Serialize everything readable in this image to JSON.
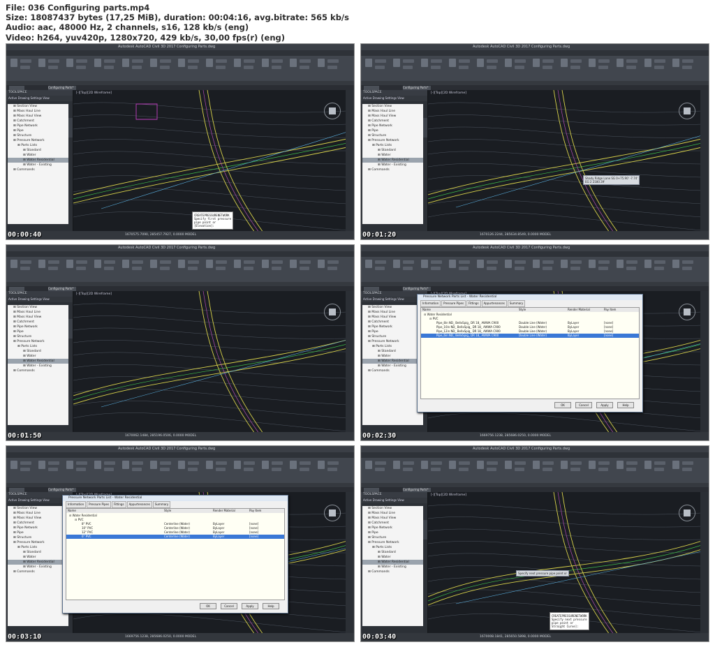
{
  "header": {
    "line1": "File: 036 Configuring parts.mp4",
    "line2": "Size: 18087437 bytes (17,25 MiB), duration: 00:04:16, avg.bitrate: 565 kb/s",
    "line3": "Audio: aac, 48000 Hz, 2 channels, s16, 128 kb/s (eng)",
    "line4": "Video: h264, yuv420p, 1280x720, 429 kb/s, 30,00 fps(r) (eng)"
  },
  "app": {
    "title": "Autodesk AutoCAD Civil 3D 2017    Configuring Parts.dwg",
    "ribbon_tabs": [
      "Home",
      "Insert",
      "Annotate",
      "Modify",
      "Analyze",
      "View",
      "Manage",
      "Output",
      "Survey",
      "Autodesk 360",
      "Help",
      "Add-ins",
      "Express Tools",
      "Vehicle Tracking",
      "Featured Apps",
      "BIM 360",
      "Performance",
      "Geolocation"
    ],
    "doc_tab": "Configuring Parts*",
    "toolspace_title": "TOOLSPACE",
    "toolspace_view": "Active Drawing Settings View",
    "tree": [
      "Section View",
      "Mass Haul Line",
      "Mass Haul View",
      "Catchment",
      "Pipe Network",
      "Pipe",
      "Structure",
      "Pressure Network",
      "Parts Lists",
      "Standard",
      "Water",
      "Water Residential",
      "Water - Existing",
      "Commands"
    ],
    "viewport_label": "[-][Top][2D Wireframe]"
  },
  "thumbnails": [
    {
      "timestamp": "00:00:40",
      "coords": "1670575.7090, 285457.7927, 0.0000  MODEL",
      "cmd": [
        "CREATEPRESSURENETWORK",
        "Specify first pressure",
        "pipe point or",
        "[Elevation]:"
      ]
    },
    {
      "timestamp": "00:01:20",
      "coords": "1670126.2244, 285634.8549, 0.0000  MODEL",
      "tooltip": [
        "Shady Ridge Lane   SG  0+75.90'  -7.74'",
        "EG   2  2180.39'"
      ]
    },
    {
      "timestamp": "00:01:50",
      "coords": "1670062.1484, 285196.0506, 0.0000  MODEL"
    },
    {
      "timestamp": "00:02:30",
      "coords": "1669756.1238, 285686.0250, 0.0000  MODEL",
      "dialog": {
        "title": "Pressure Network Parts List - Water Residential",
        "tabs": [
          "Information",
          "Pressure Pipes",
          "Fittings",
          "Appurtenances",
          "Summary"
        ],
        "cols": [
          "Name",
          "Style",
          "Render Material",
          "Pay Item"
        ],
        "root": "Water Residential",
        "group": "PVC",
        "rows": [
          {
            "name": "Pipe_8in ND_ BellxSpig_ DR 18_ AWWA C900",
            "style": "Double Line (Water)",
            "mat": "ByLayer",
            "pay": "[none]"
          },
          {
            "name": "Pipe_10in ND_ BellxSpig_ DR 18_ AWWA C900",
            "style": "Double Line (Water)",
            "mat": "ByLayer",
            "pay": "[none]"
          },
          {
            "name": "Pipe_12in ND_ BellxSpig_ DR 18_ AWWA C900",
            "style": "Double Line (Water)",
            "mat": "ByLayer",
            "pay": "[none]"
          },
          {
            "name": "Pipe_6in ND_ BellxSpig_ DR 18_ AWWA C900",
            "style": "Double Line (Water)",
            "mat": "ByLayer",
            "pay": "[none]"
          }
        ],
        "buttons": [
          "OK",
          "Cancel",
          "Apply",
          "Help"
        ]
      }
    },
    {
      "timestamp": "00:03:10",
      "coords": "1669756.1238, 285686.0250, 0.0000  MODEL",
      "dialog": {
        "title": "Pressure Network Parts List - Water Residential",
        "tabs": [
          "Information",
          "Pressure Pipes",
          "Fittings",
          "Appurtenances",
          "Summary"
        ],
        "cols": [
          "Name",
          "Style",
          "Render Material",
          "Pay Item"
        ],
        "root": "Water Residential",
        "group": "PVC",
        "rows": [
          {
            "name": "8\" PVC",
            "style": "Centerline (Water)",
            "mat": "ByLayer",
            "pay": "[none]"
          },
          {
            "name": "10\" PVC",
            "style": "Centerline (Water)",
            "mat": "ByLayer",
            "pay": "[none]"
          },
          {
            "name": "12\" PVC",
            "style": "Centerline (Water)",
            "mat": "ByLayer",
            "pay": "[none]"
          },
          {
            "name": "6\" PVC",
            "style": "Centerline (Water)",
            "mat": "ByLayer",
            "pay": "[none]"
          }
        ],
        "buttons": [
          "OK",
          "Cancel",
          "Apply",
          "Help"
        ]
      }
    },
    {
      "timestamp": "00:03:40",
      "coords": "1670008.1841, 285650.5898, 0.0000  MODEL",
      "cmd": [
        "CREATEPRESSURENETWORK",
        "Specify next pressure",
        "pipe point or",
        "Straight Curve]:"
      ],
      "tooltip": [
        "Specify next pressure pipe point or"
      ]
    }
  ]
}
